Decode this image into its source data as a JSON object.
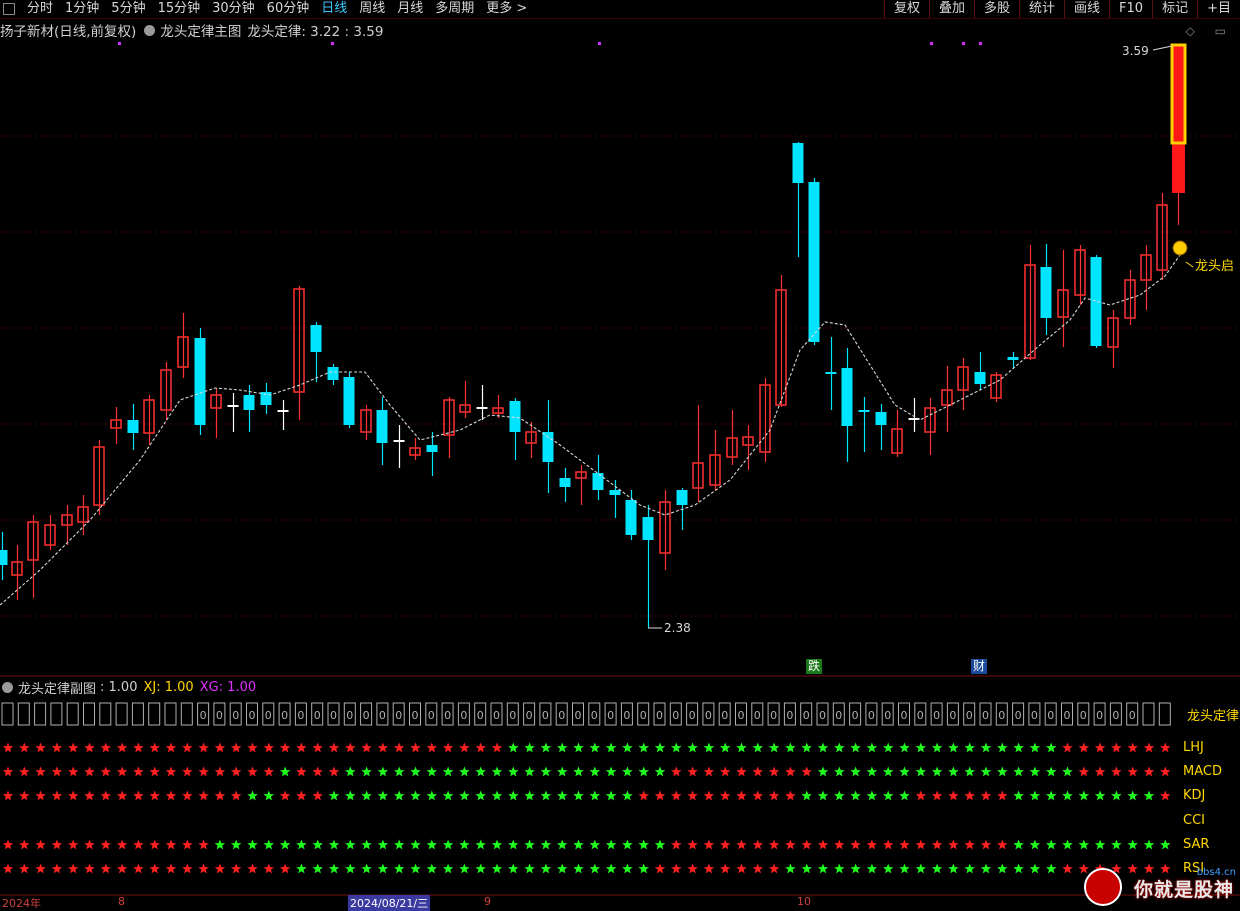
{
  "toolbar": {
    "tabs": [
      "分时",
      "1分钟",
      "5分钟",
      "15分钟",
      "30分钟",
      "60分钟",
      "日线",
      "周线",
      "月线",
      "多周期",
      "更多 >"
    ],
    "active": "日线",
    "right_tabs": [
      "复权",
      "叠加",
      "多股",
      "统计",
      "画线",
      "F10",
      "标记",
      "+目"
    ]
  },
  "chart_title": {
    "stock": "扬子新材(日线,前复权)",
    "indicator": "龙头定律主图",
    "values_label": "龙头定律: 3.22 : 3.59"
  },
  "main_chart": {
    "high_marker": "3.59",
    "low_marker": "2.38",
    "signal_label": "龙头启",
    "tag_fall": "跌",
    "tag_fin": "财",
    "colors": {
      "up": "#ff3030",
      "down": "#00e5ff",
      "flat": "#ffffff",
      "ma": "#d8d8d8"
    }
  },
  "sub_chart": {
    "title": "龙头定律副图",
    "value_main": ": 1.00",
    "xj": "XJ: 1.00",
    "xg": "XG: 1.00",
    "row_labels": [
      "龙头定律",
      "LHJ",
      "MACD",
      "KDJ",
      "CCI",
      "SAR",
      "RSI"
    ]
  },
  "bottom_axis": {
    "labels": [
      "2024年",
      "8",
      "2024/08/21/三",
      "9",
      "10"
    ]
  },
  "watermark": {
    "text": "你就是股神",
    "site": "bbs4.cn"
  },
  "chart_data": {
    "type": "candlestick",
    "high": 3.59,
    "low": 2.38,
    "signals": {
      "lhj": "RRRRRRRRRRRRRRRRRRRRRRRRRRRRRRRGGGGGGGGGGGGGGGGGGGGGGGGGGGGGGGGGGRRRRRRRRRRRRR",
      "macd": "RRRRRRRRRRRRRRRRRGRRRGGGGGGGGGGGGGGGGGGGGRRRRRRRRRGGGGGGGGGGGGGGGGRRRRRRRRRRRRR",
      "kdj": "RRRRRRRRRRRRRRRGGRRRGGGGGGGGGGGGGGGGGGGRRRRRRRRRRGGGGGGGRRRRRRGGGGGGGGGRRRRRRRRR",
      "sar": "RRRRRRRRRRRRRGGGGGGGGGGGGGGGGGGGGGGGGGGGGRRRRRRRRRRRRRRRRRRRRRGGGGGGGGGGRRRRRRRRR",
      "rsi": "RRRRRRRRRRRRRRRRRRGGGGGGGGGGGGGGGGGGGGGGRRRRRRRRGGGGGGGGGGGGGGGGGRRRRRRRRRRRRRRRR"
    }
  }
}
